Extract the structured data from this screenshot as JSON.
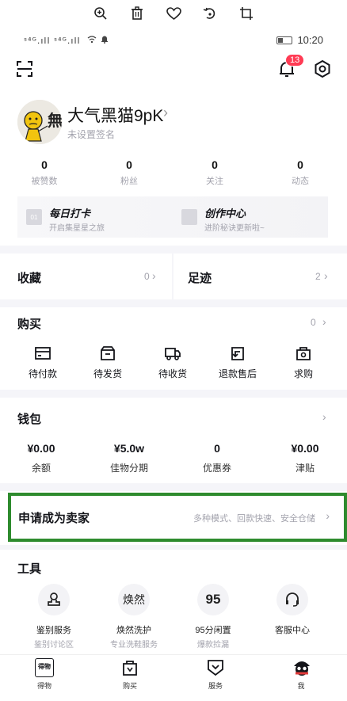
{
  "viewer_toolbar": {
    "icons": [
      "zoom-in-icon",
      "trash-icon",
      "heart-icon",
      "rotate-icon",
      "crop-icon"
    ]
  },
  "status_bar": {
    "signal": "ˢ⁴ᴳ.ıll ˢ⁴ᴳ.ıll",
    "time": "10:20"
  },
  "header": {
    "notification_count": "13"
  },
  "profile": {
    "username": "大气黑猫9pK",
    "signature": "未设置签名",
    "avatar_text": "無"
  },
  "stats": [
    {
      "value": "0",
      "label": "被赞数"
    },
    {
      "value": "0",
      "label": "粉丝"
    },
    {
      "value": "0",
      "label": "关注"
    },
    {
      "value": "0",
      "label": "动态"
    }
  ],
  "promo_cards": [
    {
      "title": "每日打卡",
      "subtitle": "开启集星星之旅",
      "icon_text": "01"
    },
    {
      "title": "创作中心",
      "subtitle": "进阶秘诀更新啦~"
    }
  ],
  "favorites": {
    "label": "收藏",
    "count": "0"
  },
  "footprints": {
    "label": "足迹",
    "count": "2"
  },
  "purchases": {
    "label": "购买",
    "count": "0",
    "items": [
      {
        "label": "待付款",
        "icon": "wallet-card-icon"
      },
      {
        "label": "待发货",
        "icon": "box-icon"
      },
      {
        "label": "待收货",
        "icon": "truck-icon"
      },
      {
        "label": "退款售后",
        "icon": "refund-icon"
      },
      {
        "label": "求购",
        "icon": "bag-icon"
      }
    ]
  },
  "wallet": {
    "label": "钱包",
    "items": [
      {
        "value": "¥0.00",
        "label": "余额"
      },
      {
        "value": "¥5.0w",
        "label": "佳物分期"
      },
      {
        "value": "0",
        "label": "优惠券"
      },
      {
        "value": "¥0.00",
        "label": "津贴"
      }
    ]
  },
  "seller": {
    "title": "申请成为卖家",
    "subtitle": "多种模式、回款快速、安全仓储"
  },
  "tools": {
    "label": "工具",
    "items": [
      {
        "label": "鉴别服务",
        "sub": "鉴别讨论区",
        "glyph": ""
      },
      {
        "label": "焕然洗护",
        "sub": "专业洗鞋服务",
        "glyph": "焕然"
      },
      {
        "label": "95分闲置",
        "sub": "爆款捡漏",
        "glyph": "95"
      },
      {
        "label": "客服中心",
        "sub": "",
        "glyph": ""
      }
    ]
  },
  "tabbar": [
    {
      "label": "得物",
      "icon_text": "得物"
    },
    {
      "label": "购买"
    },
    {
      "label": "服务"
    },
    {
      "label": "我"
    }
  ],
  "colors": {
    "accent": "#2e8b2e",
    "badge": "#ff3b54",
    "muted": "#a3a3ad",
    "divider": "#f5f5f9"
  }
}
